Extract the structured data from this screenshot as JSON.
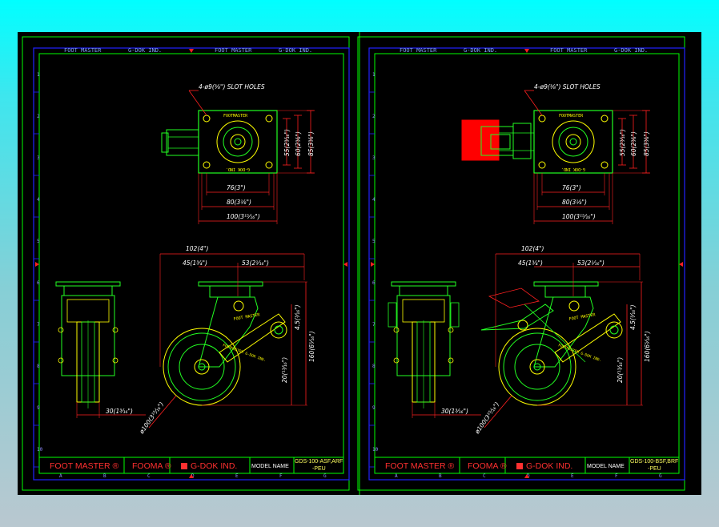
{
  "colors": {
    "background_top": "#00ffff",
    "background_bottom": "#b9c8d0",
    "canvas": "#000000",
    "frame_green": "#00ff00",
    "frame_blue": "#2222ff",
    "part_green": "#22ff22",
    "part_yellow": "#ffff00",
    "dim_red": "#ff2020",
    "brake_red": "#ff0000",
    "text_white": "#ffffff"
  },
  "sheets": [
    {
      "header": {
        "brand_1": "FOOT MASTER",
        "brand_2": "G-DOK IND.",
        "brand_3": "FOOT MASTER",
        "brand_4": "G-DOK IND."
      },
      "annotations": {
        "slot_holes": "4-ø9(³⁄₈\") SLOT HOLES",
        "dim_55": "55(2³⁄₁₆\")",
        "dim_60": "60(2³⁄₈\")",
        "dim_85": "85(3³⁄₈\")",
        "dim_76": "76(3\")",
        "dim_80": "80(3¹⁄₈\")",
        "dim_100": "100(3¹⁵⁄₁₆\")",
        "dim_102": "102(4\")",
        "dim_45": "45(1³⁄₄\")",
        "dim_53": "53(2¹⁄₁₆\")",
        "dim_4_5": "4.5(³⁄₁₆\")",
        "dim_160": "160(6⁵⁄₁₆\")",
        "dim_20": "20(¹³⁄₁₆\")",
        "dim_30": "30(1³⁄₁₆\")",
        "dim_wheel": "ø100(3¹⁵⁄₁₆\")",
        "plate_logo": "FOOTMASTER",
        "plate_code": "G-DOK IND.",
        "arm_label": "FOOT MASTER",
        "wheel_label": "FOOTMASTER G-DOK IND."
      },
      "title_block": {
        "brand": "FOOT MASTER ®",
        "sub_brand": "FOOMA ®",
        "company": "G-DOK IND.",
        "model_label": "MODEL  NAME",
        "model_name_line1": "GDS-100-ASF,ARF",
        "model_name_line2": "-PEU"
      },
      "has_brake": false
    },
    {
      "header": {
        "brand_1": "FOOT MASTER",
        "brand_2": "G-DOK IND.",
        "brand_3": "FOOT MASTER",
        "brand_4": "G-DOK IND."
      },
      "annotations": {
        "slot_holes": "4-ø9(³⁄₈\") SLOT HOLES",
        "dim_55": "55(2³⁄₁₆\")",
        "dim_60": "60(2³⁄₈\")",
        "dim_85": "85(3³⁄₈\")",
        "dim_76": "76(3\")",
        "dim_80": "80(3¹⁄₈\")",
        "dim_100": "100(3¹⁵⁄₁₆\")",
        "dim_102": "102(4\")",
        "dim_45": "45(1³⁄₄\")",
        "dim_53": "53(2¹⁄₁₆\")",
        "dim_4_5": "4.5(³⁄₁₆\")",
        "dim_160": "160(6⁵⁄₁₆\")",
        "dim_20": "20(¹³⁄₁₆\")",
        "dim_30": "30(1³⁄₁₆\")",
        "dim_wheel": "ø100(3¹⁵⁄₁₆\")",
        "plate_logo": "FOOTMASTER",
        "plate_code": "G-DOK IND.",
        "arm_label": "FOOT MASTER",
        "wheel_label": "FOOTMASTER G-DOK IND."
      },
      "title_block": {
        "brand": "FOOT MASTER ®",
        "sub_brand": "FOOMA ®",
        "company": "G-DOK IND.",
        "model_label": "MODEL  NAME",
        "model_name_line1": "GDS-100-BSF,BRF",
        "model_name_line2": "-PEU"
      },
      "has_brake": true
    }
  ],
  "grid_letters": [
    "A",
    "B",
    "C",
    "D",
    "E",
    "F",
    "G"
  ],
  "grid_numbers": [
    "1",
    "2",
    "3",
    "4",
    "5",
    "6",
    "7",
    "8",
    "9",
    "10"
  ]
}
